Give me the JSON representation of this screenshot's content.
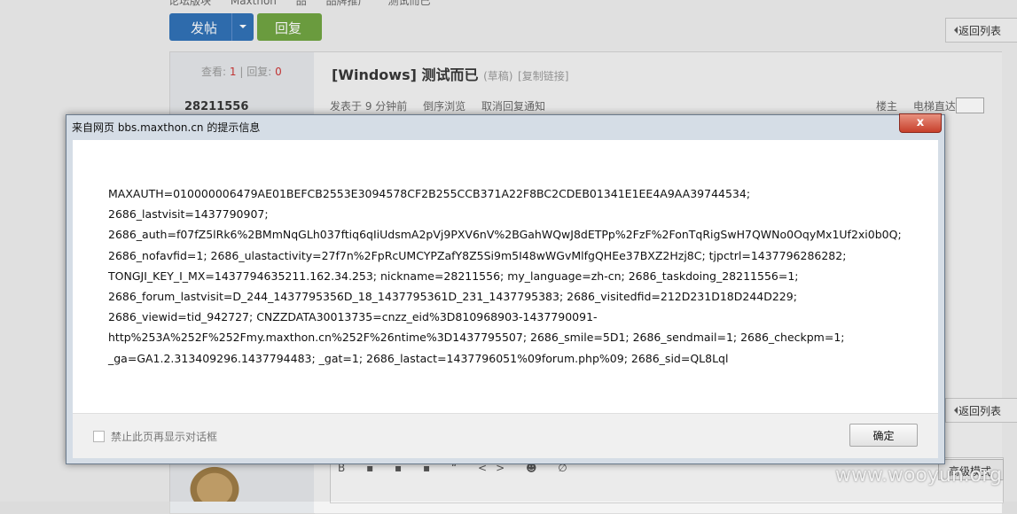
{
  "background": {
    "breadcrumb": [
      "论坛版块",
      "Maxthon",
      "品",
      "品牌推广",
      "测试而已"
    ],
    "post_button": "发帖",
    "reply_button": "回复",
    "back_to_list": "返回列表",
    "stats": {
      "views_label": "查看:",
      "views": "1",
      "replies_label": "回复:",
      "replies": "0"
    },
    "username": "28211556",
    "thread_title": "[Windows] 测试而已",
    "thread_tag": "(草稿)",
    "copy_link": "[复制链接]",
    "meta": {
      "posted": "发表于 9 分钟前",
      "reverse": "倒序浏览",
      "cancel_notify": "取消回复通知"
    },
    "floor": {
      "owner": "楼主",
      "jump": "电梯直达"
    },
    "advanced_mode": "高级模式",
    "editor_tools": [
      "B",
      "▪",
      "▪",
      "▪",
      "“",
      "<>",
      "☻",
      "∅"
    ],
    "watermark": "www.wooyun.org"
  },
  "dialog": {
    "title": "来自网页 bbs.maxthon.cn 的提示信息",
    "close_label": "x",
    "message_lines": [
      "MAXAUTH=010000006479AE01BEFCB2553E3094578CF2B255CCB371A22F8BC2CDEB01341E1EE4A9AA39744534;",
      "2686_lastvisit=1437790907;",
      "2686_auth=f07fZ5lRk6%2BMmNqGLh037ftiq6qIiUdsmA2pVj9PXV6nV%2BGahWQwJ8dETPp%2FzF%2FonTqRigSwH7QWNo0OqyMx1Uf2xi0b0Q;",
      "2686_nofavfid=1; 2686_ulastactivity=27f7n%2FpRcUMCYPZafY8Z5Si9m5I48wWGvMlfgQHEe37BXZ2Hzj8C; tjpctrl=1437796286282;",
      "TONGJI_KEY_I_MX=1437794635211.162.34.253; nickname=28211556; my_language=zh-cn; 2686_taskdoing_28211556=1;",
      "2686_forum_lastvisit=D_244_1437795356D_18_1437795361D_231_1437795383; 2686_visitedfid=212D231D18D244D229;",
      "2686_viewid=tid_942727; CNZZDATA30013735=cnzz_eid%3D810968903-1437790091-",
      "http%253A%252F%252Fmy.maxthon.cn%252F%26ntime%3D1437795507; 2686_smile=5D1; 2686_sendmail=1; 2686_checkpm=1;",
      "_ga=GA1.2.313409296.1437794483; _gat=1; 2686_lastact=1437796051%09forum.php%09; 2686_sid=QL8Lql"
    ],
    "checkbox_label": "禁止此页再显示对话框",
    "checkbox_checked": false,
    "ok_label": "确定"
  }
}
